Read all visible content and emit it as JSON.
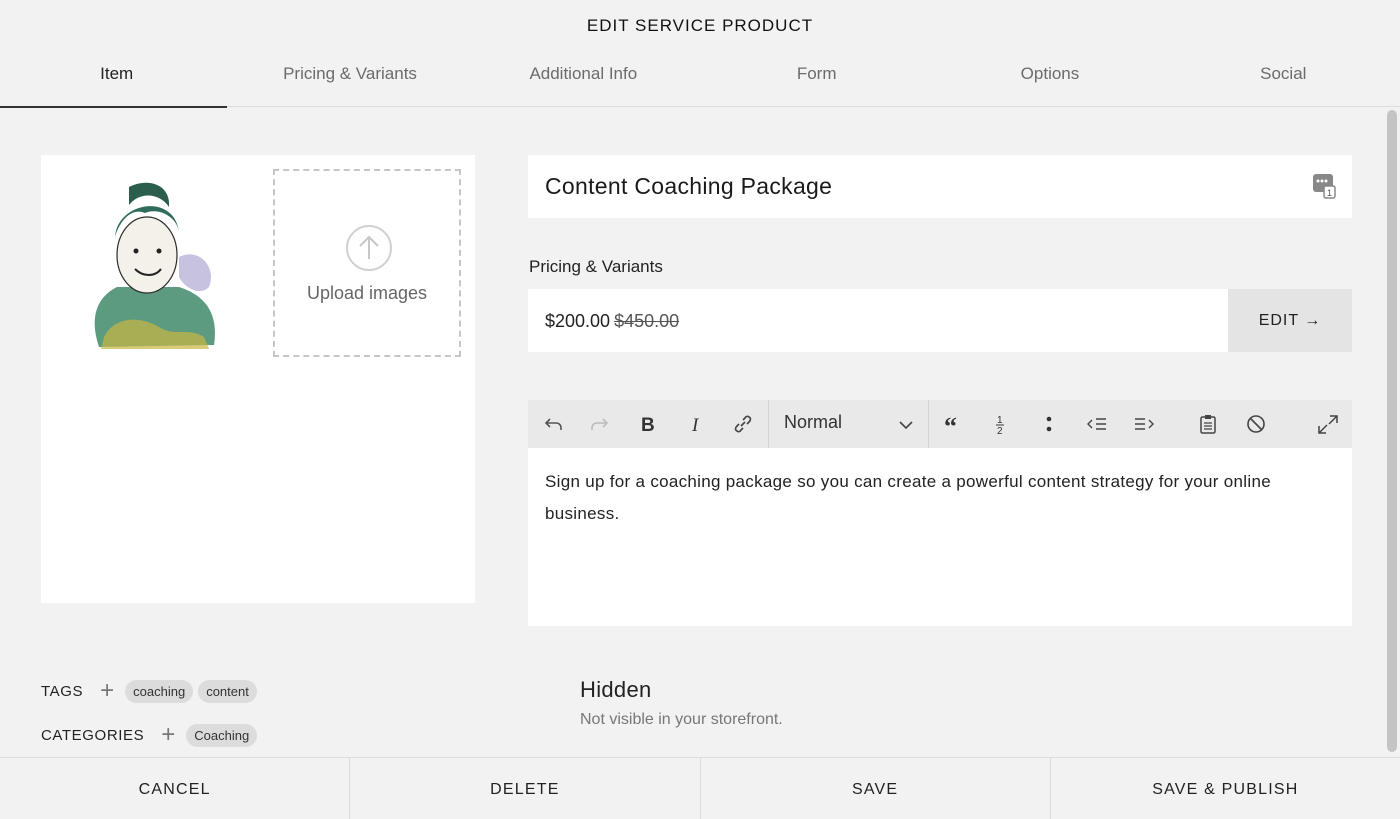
{
  "dialog": {
    "title": "EDIT SERVICE PRODUCT"
  },
  "tabs": [
    {
      "label": "Item",
      "active": true
    },
    {
      "label": "Pricing & Variants",
      "active": false
    },
    {
      "label": "Additional Info",
      "active": false
    },
    {
      "label": "Form",
      "active": false
    },
    {
      "label": "Options",
      "active": false
    },
    {
      "label": "Social",
      "active": false
    }
  ],
  "images": {
    "upload_label": "Upload images"
  },
  "item": {
    "title": "Content Coaching Package"
  },
  "pricing": {
    "heading": "Pricing & Variants",
    "price": "$200.00",
    "original_price": "$450.00",
    "edit_label": "EDIT →"
  },
  "editor": {
    "format_select": "Normal",
    "body": "Sign up for a coaching package so you can create a powerful content strategy for your online business."
  },
  "tags": {
    "label": "TAGS",
    "items": [
      "coaching",
      "content"
    ]
  },
  "categories": {
    "label": "CATEGORIES",
    "items": [
      "Coaching"
    ]
  },
  "visibility": {
    "title": "Hidden",
    "description": "Not visible in your storefront."
  },
  "footer": {
    "cancel": "CANCEL",
    "delete": "DELETE",
    "save": "SAVE",
    "save_publish": "SAVE & PUBLISH"
  },
  "colors": {
    "background": "#f2f2f2",
    "panel": "#ffffff",
    "toolbar": "#e9e9e9",
    "pill": "#dcdcdc"
  }
}
